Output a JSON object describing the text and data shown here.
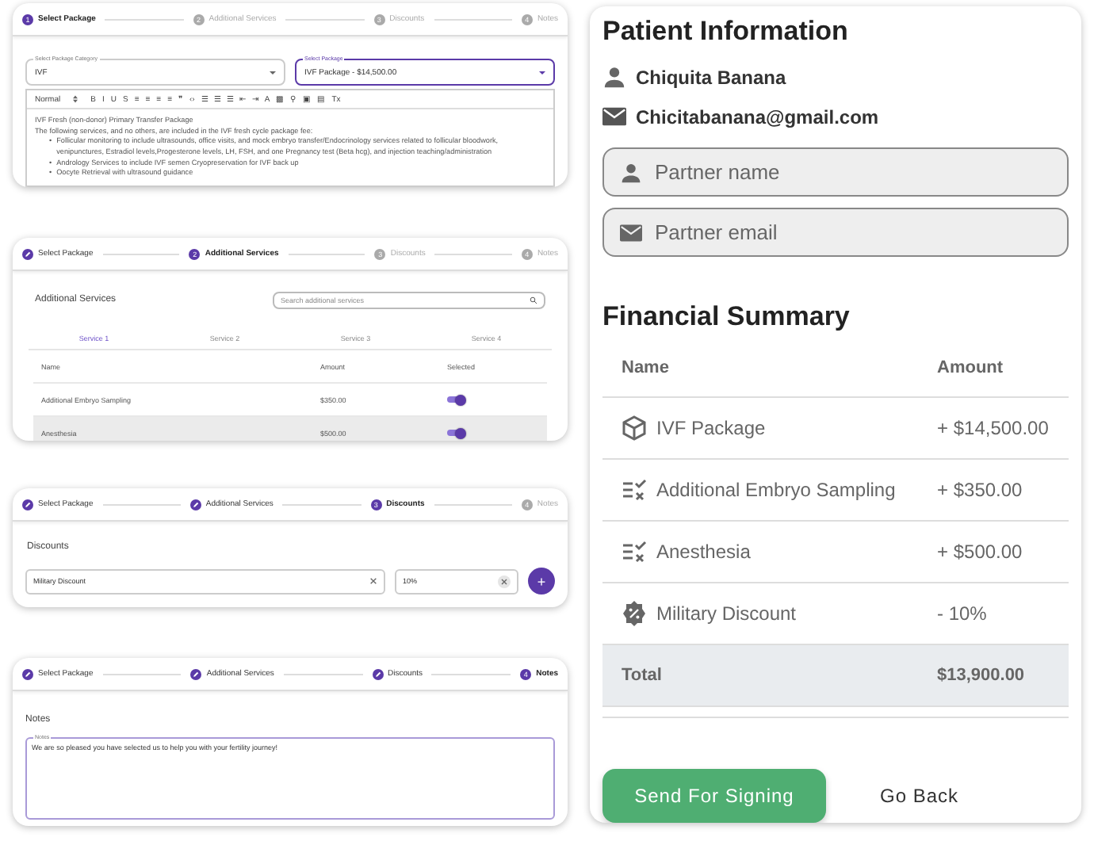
{
  "package_card": {
    "steps": [
      {
        "label": "Select Package",
        "number": "1",
        "done": false,
        "selected": true
      },
      {
        "label": "Additional Services",
        "number": "2",
        "done": false,
        "selected": false
      },
      {
        "label": "Discounts",
        "number": "3",
        "done": false,
        "selected": false
      },
      {
        "label": "Notes",
        "number": "4",
        "done": false,
        "selected": false
      }
    ],
    "category_field": {
      "label": "Select Package Category",
      "value": "IVF",
      "focused": false
    },
    "package_field": {
      "label": "Select Package",
      "value": "IVF Package - $14,500.00",
      "focused": true
    },
    "toolbar": {
      "format": "Normal",
      "buttons": [
        "B",
        "I",
        "U",
        "S",
        "≡",
        "≡",
        "≡",
        "≡",
        "❞",
        "‹›",
        "☰",
        "☰",
        "☰",
        "⇤",
        "⇥",
        "A",
        "▩",
        "⚲",
        "▣",
        "▤",
        "Tx"
      ]
    },
    "editor": {
      "marker": "•",
      "title": "IVF Fresh (non-donor) Primary Transfer Package",
      "intro": "The following services, and no others, are included in the IVF fresh cycle package fee:",
      "bullets": [
        "Follicular monitoring to include ultrasounds, office visits, and mock embryo transfer/Endocrinology services related to follicular bloodwork, venipunctures, Estradiol levels,Progesterone levels, LH, FSH, and one Pregnancy test (Beta hcg), and injection teaching/administration",
        "Andrology Services to include IVF semen Cryopreservation for IVF back up",
        "Oocyte Retrieval with ultrasound guidance"
      ]
    }
  },
  "services_card": {
    "steps": [
      {
        "label": "Select Package",
        "done": true,
        "selected": false
      },
      {
        "label": "Additional Services",
        "number": "2",
        "done": false,
        "selected": true
      },
      {
        "label": "Discounts",
        "number": "3",
        "done": false,
        "selected": false
      },
      {
        "label": "Notes",
        "number": "4",
        "done": false,
        "selected": false
      }
    ],
    "title": "Additional Services",
    "search": {
      "placeholder": "Search additional services"
    },
    "tabs": [
      {
        "label": "Service 1",
        "selected": true
      },
      {
        "label": "Service 2",
        "selected": false
      },
      {
        "label": "Service 3",
        "selected": false
      },
      {
        "label": "Service 4",
        "selected": false
      }
    ],
    "columns": [
      "Name",
      "Amount",
      "Selected"
    ],
    "rows": [
      {
        "name": "Additional Embryo Sampling",
        "amount": "$350.00",
        "selected": true,
        "highlighted": false
      },
      {
        "name": "Anesthesia",
        "amount": "$500.00",
        "selected": true,
        "highlighted": true
      }
    ]
  },
  "discounts_card": {
    "steps": [
      {
        "label": "Select Package",
        "done": true,
        "selected": false
      },
      {
        "label": "Additional Services",
        "done": true,
        "selected": false
      },
      {
        "label": "Discounts",
        "number": "3",
        "done": false,
        "selected": true
      },
      {
        "label": "Notes",
        "number": "4",
        "done": false,
        "selected": false
      }
    ],
    "title": "Discounts",
    "discount_field": {
      "value": "Military Discount"
    },
    "percent_field": {
      "value": "10%"
    },
    "add_button": "+"
  },
  "notes_card": {
    "steps": [
      {
        "label": "Select Package",
        "done": true,
        "selected": false
      },
      {
        "label": "Additional Services",
        "done": true,
        "selected": false
      },
      {
        "label": "Discounts",
        "done": true,
        "selected": false
      },
      {
        "label": "Notes",
        "number": "4",
        "done": false,
        "selected": true
      }
    ],
    "title": "Notes",
    "notes_field": {
      "label": "Notes",
      "value": "We are so pleased you have selected us to help you with your fertility journey!"
    }
  },
  "patient": {
    "title": "Patient Information",
    "name": "Chiquita Banana",
    "email": "Chicitabanana@gmail.com",
    "partner_name": {
      "placeholder": "Partner name"
    },
    "partner_email": {
      "placeholder": "Partner email"
    }
  },
  "financial_summary": {
    "title": "Financial Summary",
    "columns": [
      "Name",
      "Amount"
    ],
    "rows": [
      {
        "kind": "package",
        "name": "IVF Package",
        "amount": "+ $14,500.00"
      },
      {
        "kind": "service",
        "name": "Additional Embryo Sampling",
        "amount": "+ $350.00"
      },
      {
        "kind": "service",
        "name": "Anesthesia",
        "amount": "+ $500.00"
      },
      {
        "kind": "discount",
        "name": "Military Discount",
        "amount": "- 10%"
      }
    ],
    "total": {
      "label": "Total",
      "amount": "$13,900.00"
    }
  },
  "buttons": {
    "primary": "Send For Signing",
    "secondary": "Go Back"
  }
}
